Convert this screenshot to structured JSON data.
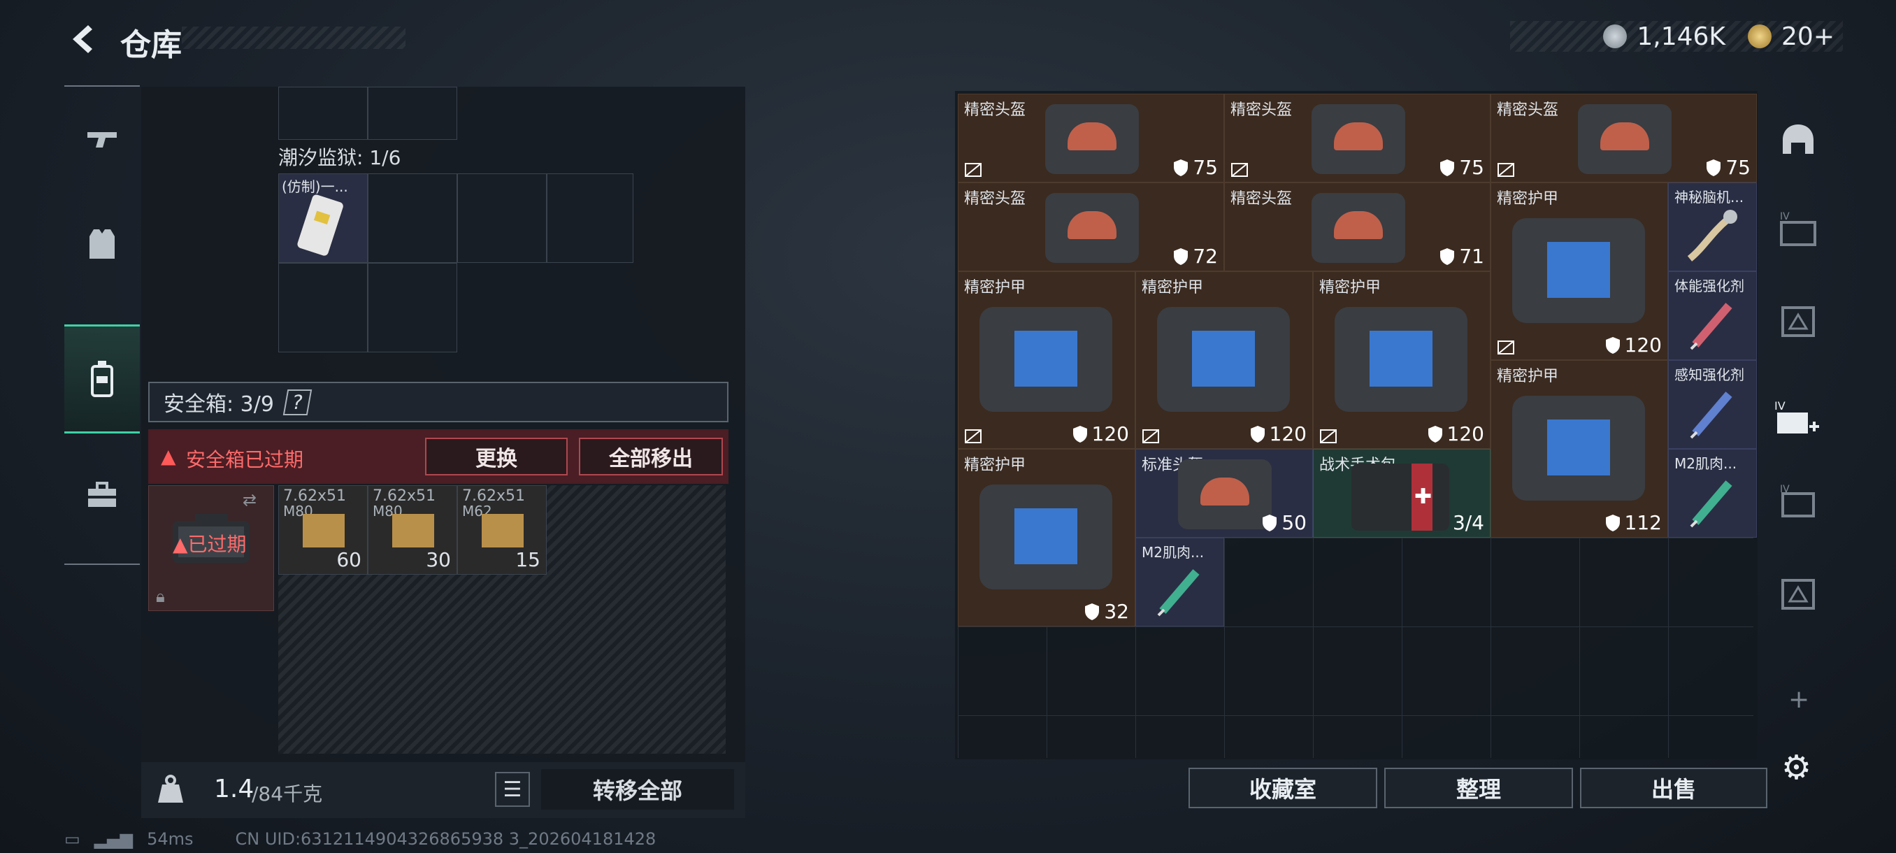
{
  "header": {
    "title": "仓库"
  },
  "currency": {
    "money": "1,146K",
    "tokens": "20+"
  },
  "left_nav": [
    {
      "name": "weapon"
    },
    {
      "name": "armor"
    },
    {
      "name": "backpack"
    },
    {
      "name": "toolbox"
    }
  ],
  "left_panel": {
    "container_label": "潮汐监狱: 1/6",
    "container_item": "(仿制)一...",
    "safe_box_label": "安全箱: 3/9",
    "safe_box_help": "?",
    "alert_text": "安全箱已过期",
    "replace_button": "更换",
    "remove_all_button": "全部移出",
    "expired_label": "已过期",
    "ammo": [
      {
        "name": "7.62x51",
        "sub": "M80",
        "count": "60"
      },
      {
        "name": "7.62x51",
        "sub": "M80",
        "count": "30"
      },
      {
        "name": "7.62x51",
        "sub": "M62",
        "count": "15"
      }
    ],
    "weight": "1.4",
    "weight_max": "/84千克",
    "transfer_all_button": "转移全部"
  },
  "right_panel": {
    "items": [
      {
        "label": "精密头盔",
        "dur": "75"
      },
      {
        "label": "精密头盔",
        "dur": "75"
      },
      {
        "label": "精密头盔",
        "dur": "75"
      },
      {
        "label": "精密头盔",
        "dur": "72"
      },
      {
        "label": "精密头盔",
        "dur": "71"
      },
      {
        "label": "精密护甲",
        "dur": "120"
      },
      {
        "label": "神秘脑机..."
      },
      {
        "label": "精密护甲",
        "dur": "120"
      },
      {
        "label": "精密护甲",
        "dur": "120"
      },
      {
        "label": "精密护甲",
        "dur": "120"
      },
      {
        "label": "体能强化剂"
      },
      {
        "label": "精密护甲",
        "dur": "112"
      },
      {
        "label": "感知强化剂"
      },
      {
        "label": "精密护甲",
        "dur": "32"
      },
      {
        "label": "标准头盔",
        "dur": "50"
      },
      {
        "label": "战术手术包",
        "count": "3/4"
      },
      {
        "label": "M2肌肉..."
      },
      {
        "label": "M2肌肉..."
      }
    ],
    "collection_button": "收藏室",
    "sort_button": "整理",
    "sell_button": "出售"
  },
  "status_bar": {
    "ping": "54ms",
    "uid": "CN UID:6312114904326865938 3_202604181428"
  },
  "colors": {
    "accent": "#3fd1a6",
    "alert_bg": "#4a1e24",
    "alert_text": "#e05a5a",
    "item_brown": "#3b2a1f",
    "item_blue": "#2a2e44"
  }
}
